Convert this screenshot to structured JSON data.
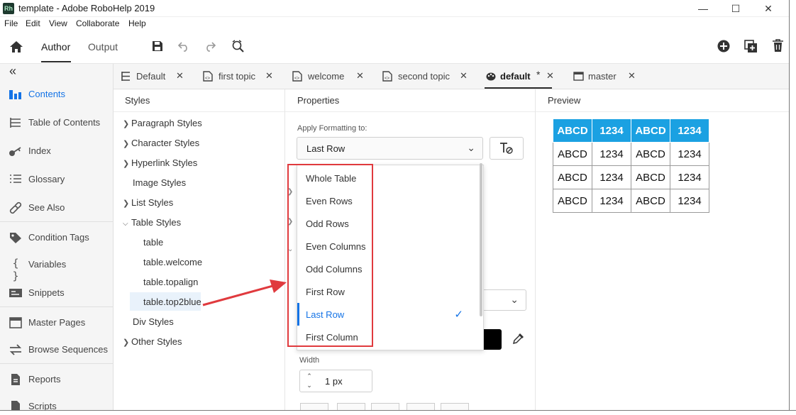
{
  "window": {
    "app_icon_text": "Rh",
    "title": "template - Adobe RoboHelp 2019"
  },
  "menu": [
    "File",
    "Edit",
    "View",
    "Collaborate",
    "Help"
  ],
  "toolbar": {
    "modes": [
      "Author",
      "Output"
    ]
  },
  "leftnav": {
    "collapse_glyph": "«",
    "items": [
      {
        "label": "Contents",
        "icon": "contents-icon"
      },
      {
        "label": "Table of Contents",
        "icon": "toc-icon"
      },
      {
        "label": "Index",
        "icon": "index-icon"
      },
      {
        "label": "Glossary",
        "icon": "glossary-icon"
      },
      {
        "label": "See Also",
        "icon": "see-also-icon"
      },
      {
        "label": "Condition Tags",
        "icon": "condition-tags-icon"
      },
      {
        "label": "Variables",
        "icon": "variables-icon"
      },
      {
        "label": "Snippets",
        "icon": "snippets-icon"
      },
      {
        "label": "Master Pages",
        "icon": "master-pages-icon"
      },
      {
        "label": "Browse Sequences",
        "icon": "browse-sequences-icon"
      },
      {
        "label": "Reports",
        "icon": "reports-icon"
      },
      {
        "label": "Scripts",
        "icon": "scripts-icon"
      }
    ]
  },
  "doctabs": [
    {
      "label": "Default",
      "modified": ""
    },
    {
      "label": "first topic",
      "modified": ""
    },
    {
      "label": "welcome",
      "modified": ""
    },
    {
      "label": "second topic",
      "modified": ""
    },
    {
      "label": "default",
      "modified": "*"
    },
    {
      "label": "master",
      "modified": ""
    }
  ],
  "panels": {
    "styles": "Styles",
    "properties": "Properties",
    "preview": "Preview"
  },
  "styles_tree": {
    "paragraph": "Paragraph Styles",
    "character": "Character Styles",
    "hyperlink": "Hyperlink Styles",
    "image": "Image Styles",
    "list": "List Styles",
    "table": "Table Styles",
    "table_children": [
      "table",
      "table.welcome",
      "table.topalign",
      "table.top2blue"
    ],
    "div": "Div Styles",
    "other": "Other Styles"
  },
  "properties": {
    "apply_label": "Apply Formatting to:",
    "apply_value": "Last Row",
    "options": [
      "Whole Table",
      "Even Rows",
      "Odd Rows",
      "Even Columns",
      "Odd Columns",
      "First Row",
      "Last Row",
      "First Column"
    ],
    "selected_option": "Last Row",
    "width_label": "Width",
    "width_value": "1 px"
  },
  "preview": {
    "header": [
      "ABCD",
      "1234",
      "ABCD",
      "1234"
    ],
    "rows": [
      [
        "ABCD",
        "1234",
        "ABCD",
        "1234"
      ],
      [
        "ABCD",
        "1234",
        "ABCD",
        "1234"
      ],
      [
        "ABCD",
        "1234",
        "ABCD",
        "1234"
      ]
    ]
  },
  "colors": {
    "accent": "#1473e6",
    "preview_header": "#1ba1e2",
    "highlight_red": "#e03a3e",
    "swatch": "#000000"
  }
}
